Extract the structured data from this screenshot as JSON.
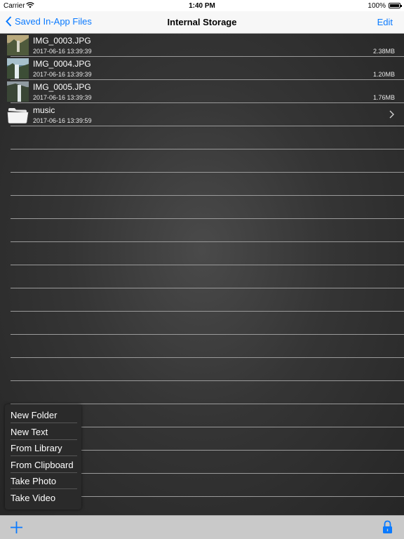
{
  "status_bar": {
    "carrier": "Carrier",
    "time": "1:40 PM",
    "battery": "100%"
  },
  "nav": {
    "back_label": "Saved In-App Files",
    "title": "Internal Storage",
    "edit_label": "Edit"
  },
  "files": [
    {
      "name": "IMG_0003.JPG",
      "date": "2017-06-16 13:39:39",
      "size": "2.38MB",
      "icon": "image-thumbnail"
    },
    {
      "name": "IMG_0004.JPG",
      "date": "2017-06-16 13:39:39",
      "size": "1.20MB",
      "icon": "image-thumbnail"
    },
    {
      "name": "IMG_0005.JPG",
      "date": "2017-06-16 13:39:39",
      "size": "1.76MB",
      "icon": "image-thumbnail"
    },
    {
      "name": "music",
      "date": "2017-06-16 13:39:59",
      "size": "",
      "icon": "folder-icon"
    }
  ],
  "menu": {
    "items": [
      "New Folder",
      "New Text",
      "From Library",
      "From Clipboard",
      "Take Photo",
      "Take Video"
    ]
  },
  "toolbar": {
    "add_icon": "plus-icon",
    "lock_icon": "lock-icon"
  },
  "colors": {
    "accent": "#0a7aff"
  }
}
